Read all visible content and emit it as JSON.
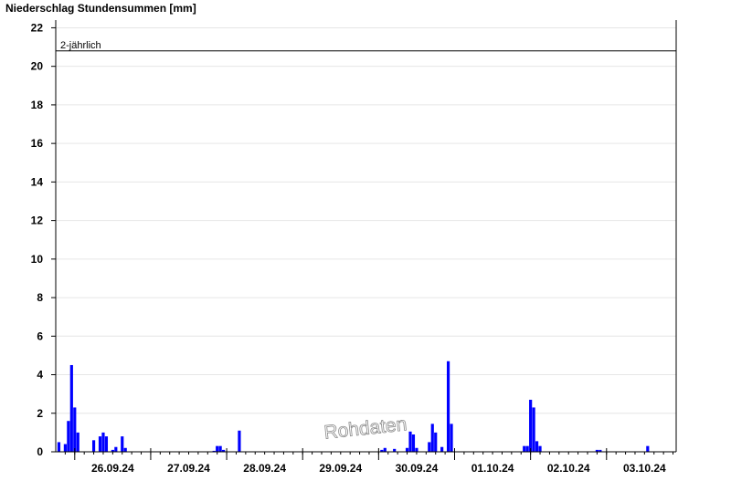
{
  "chart_data": {
    "type": "bar",
    "title": "Niederschlag Stundensummen [mm]",
    "xlabel": "",
    "ylabel": "",
    "ylim": [
      0,
      22.4
    ],
    "yticks": [
      0,
      2,
      4,
      6,
      8,
      10,
      12,
      14,
      16,
      18,
      20,
      22
    ],
    "x_unit": "hours since 25.09.24 18:00",
    "xlim": [
      0,
      196
    ],
    "day_labels": [
      {
        "label": "26.09.24",
        "hour": 18
      },
      {
        "label": "27.09.24",
        "hour": 42
      },
      {
        "label": "28.09.24",
        "hour": 66
      },
      {
        "label": "29.09.24",
        "hour": 90
      },
      {
        "label": "30.09.24",
        "hour": 114
      },
      {
        "label": "01.10.24",
        "hour": 138
      },
      {
        "label": "02.10.24",
        "hour": 162
      },
      {
        "label": "03.10.24",
        "hour": 186
      }
    ],
    "major_ticks": [
      6,
      30,
      54,
      78,
      102,
      126,
      150,
      174
    ],
    "threshold": {
      "label": "2-jährlich",
      "value": 20.8
    },
    "grid": true,
    "bar_color": "#0000ff",
    "series": [
      {
        "name": "",
        "x": [
          1,
          3,
          4,
          5,
          6,
          7,
          12,
          14,
          15,
          16,
          18,
          19,
          21,
          22,
          50,
          51,
          52,
          53,
          58,
          103,
          104,
          107,
          111,
          112,
          113,
          114,
          118,
          119,
          120,
          122,
          124,
          125,
          148,
          149,
          150,
          151,
          152,
          153,
          171,
          172,
          187
        ],
        "values": [
          0.5,
          0.4,
          1.6,
          4.5,
          2.3,
          1.0,
          0.6,
          0.8,
          1.0,
          0.8,
          0.1,
          0.25,
          0.8,
          0.2,
          0.05,
          0.3,
          0.3,
          0.1,
          1.1,
          0.1,
          0.2,
          0.15,
          0.2,
          1.05,
          0.9,
          0.2,
          0.5,
          1.45,
          1.0,
          0.25,
          4.7,
          1.45,
          0.3,
          0.3,
          2.7,
          2.3,
          0.55,
          0.3,
          0.1,
          0.1,
          0.3
        ]
      }
    ]
  },
  "watermark": "Rohdaten"
}
